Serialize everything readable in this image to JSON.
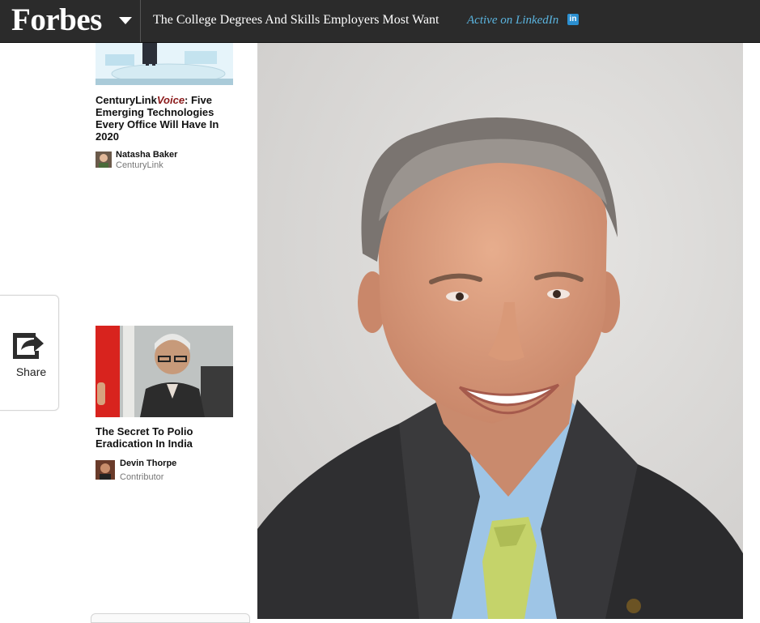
{
  "header": {
    "logo": "Forbes",
    "article_title": "The College Degrees And Skills Employers Most Want",
    "active_on": "Active on LinkedIn",
    "linkedin_badge": "in",
    "background": "#2b2b2b",
    "accent": "#5bb5e0"
  },
  "sidebar": {
    "stories": [
      {
        "brand": "CenturyLink",
        "brand_suffix": "Voice",
        "title_rest": ": Five Emerging Technologies Every Office Will Have In 2020",
        "author": "Natasha Baker",
        "role": "CenturyLink"
      },
      {
        "title": "The Secret To Polio Eradication In India",
        "author": "Devin Thorpe",
        "role": "Contributor"
      }
    ]
  },
  "share": {
    "label": "Share",
    "icon": "share-arrow-icon"
  },
  "hero": {
    "alt": "portrait-photo"
  }
}
